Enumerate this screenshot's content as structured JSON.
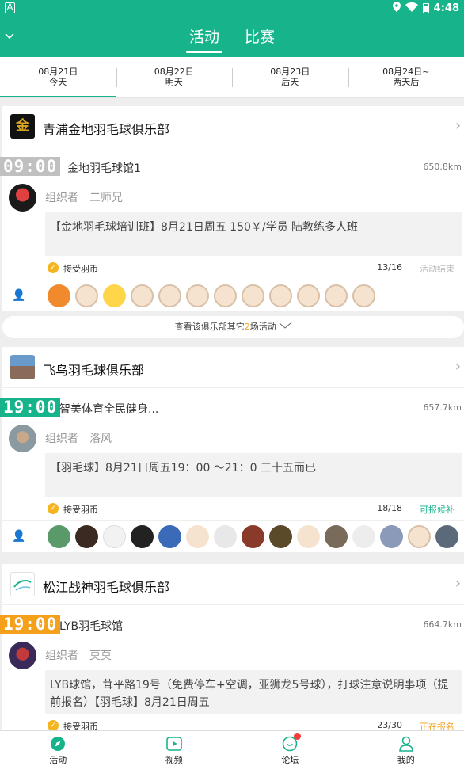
{
  "status_bar": {
    "left_icon": "A",
    "time": "4:48"
  },
  "header": {
    "tabs": [
      {
        "label": "活动",
        "active": true
      },
      {
        "label": "比赛",
        "active": false
      }
    ]
  },
  "dates": [
    {
      "date": "08月21日",
      "label": "今天",
      "active": true
    },
    {
      "date": "08月22日",
      "label": "明天",
      "active": false
    },
    {
      "date": "08月23日",
      "label": "后天",
      "active": false
    },
    {
      "date": "08月24日~",
      "label": "两天后",
      "active": false
    }
  ],
  "cards": [
    {
      "club": "青浦金地羽毛球俱乐部",
      "time": "09:00",
      "time_color": "#c0c0c0",
      "venue": "金地羽毛球馆1",
      "distance": "650.8km",
      "organizer_label": "组织者",
      "organizer": "二师兄",
      "description": "【金地羽毛球培训班】8月21日周五 150￥/学员 陆教练多人班",
      "coin_label": "接受羽币",
      "count": "13/16",
      "status": "活动结束",
      "status_color": "#bbbbbb"
    },
    {
      "club": "飞鸟羽毛球俱乐部",
      "time": "19:00",
      "time_color": "#17b48c",
      "venue": "智美体育全民健身...",
      "distance": "657.7km",
      "organizer_label": "组织者",
      "organizer": "洛风",
      "description": "【羽毛球】8月21日周五19：00 ～21：0 三十五而已",
      "coin_label": "接受羽币",
      "count": "18/18",
      "status": "可报候补",
      "status_color": "#17b48c"
    },
    {
      "club": "松江战神羽毛球俱乐部",
      "time": "19:00",
      "time_color": "#f5a01a",
      "venue": "LYB羽毛球馆",
      "distance": "664.7km",
      "organizer_label": "组织者",
      "organizer": "莫莫",
      "description": "LYB球馆，茸平路19号（免费停车+空调，亚狮龙5号球），打球注意说明事项（提前报名）【羽毛球】8月21日周五",
      "coin_label": "接受羽币",
      "count": "23/30",
      "status": "正在报名",
      "status_color": "#f5a01a"
    }
  ],
  "more_activities": {
    "prefix": "查看该俱乐部其它",
    "count": "2",
    "suffix": "场活动"
  },
  "bottom_tabs": [
    {
      "label": "活动",
      "icon": "activity-compass-icon"
    },
    {
      "label": "视频",
      "icon": "video-play-icon"
    },
    {
      "label": "论坛",
      "icon": "forum-chat-icon"
    },
    {
      "label": "我的",
      "icon": "profile-person-icon"
    }
  ],
  "colors": {
    "brand": "#17b48c",
    "accent": "#f5a01a",
    "badge_red": "#f23b3b"
  }
}
